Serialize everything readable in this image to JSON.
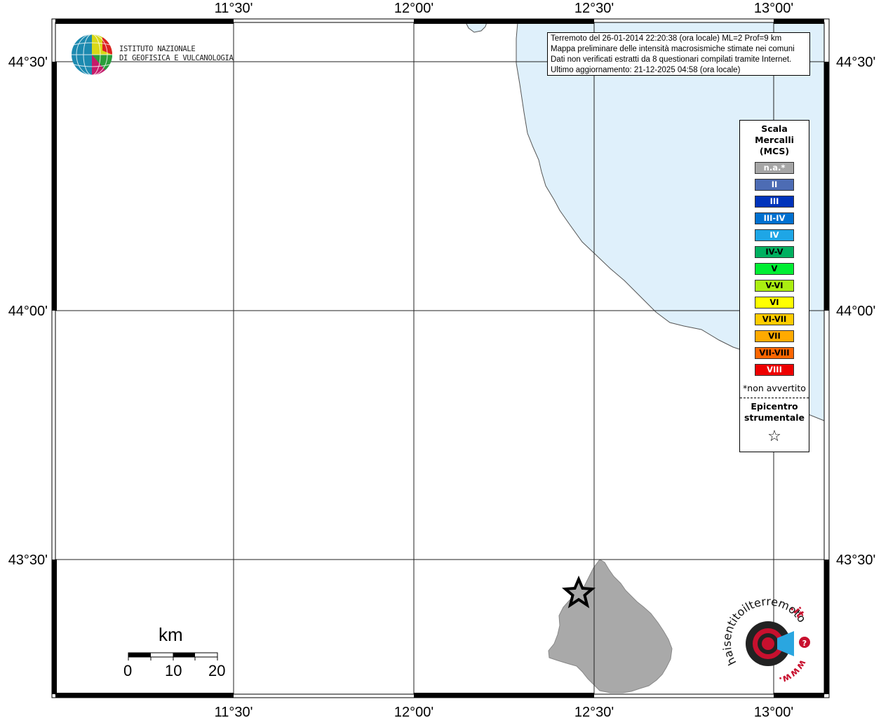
{
  "map": {
    "longitude_labels": [
      "11°30'",
      "12°00'",
      "12°30'",
      "13°00'"
    ],
    "latitude_labels": [
      "44°30'",
      "44°00'",
      "43°30'"
    ],
    "sea_color": "#dff0fb",
    "land_region_color": "#a9a9a9"
  },
  "logo": {
    "line1": "ISTITUTO NAZIONALE",
    "line2": "DI GEOFISICA E VULCANOLOGIA"
  },
  "info": {
    "line1": "Terremoto del 26-01-2014 22:20:38 (ora locale) ML=2 Prof=9 km",
    "line2": "Mappa preliminare delle intensità macrosismiche stimate nei comuni",
    "line3": "Dati non verificati estratti da 8 questionari compilati tramite Internet.",
    "line4": "Ultimo aggiornamento: 21-12-2025 04:58 (ora locale)"
  },
  "legend": {
    "title_line1": "Scala",
    "title_line2": "Mercalli",
    "title_line3": "(MCS)",
    "items": [
      {
        "label": "n.a.*",
        "color": "#a6a6a6",
        "text_color": "#ffffff"
      },
      {
        "label": "II",
        "color": "#4d6cb4",
        "text_color": "#ffffff"
      },
      {
        "label": "III",
        "color": "#0033bb",
        "text_color": "#ffffff"
      },
      {
        "label": "III-IV",
        "color": "#0070d0",
        "text_color": "#ffffff"
      },
      {
        "label": "IV",
        "color": "#1ea6e6",
        "text_color": "#ffffff"
      },
      {
        "label": "IV-V",
        "color": "#00b060",
        "text_color": "#000000"
      },
      {
        "label": "V",
        "color": "#00ee33",
        "text_color": "#000000"
      },
      {
        "label": "V-VI",
        "color": "#aaee11",
        "text_color": "#000000"
      },
      {
        "label": "VI",
        "color": "#ffff00",
        "text_color": "#000000"
      },
      {
        "label": "VI-VII",
        "color": "#ffcc00",
        "text_color": "#000000"
      },
      {
        "label": "VII",
        "color": "#ffaa00",
        "text_color": "#000000"
      },
      {
        "label": "VII-VIII",
        "color": "#ff6600",
        "text_color": "#000000"
      },
      {
        "label": "VIII",
        "color": "#ee0000",
        "text_color": "#ffffff"
      }
    ],
    "note": "*non avvertito",
    "epicenter_line1": "Epicentro",
    "epicenter_line2": "strumentale",
    "epicenter_symbol": "☆"
  },
  "scalebar": {
    "unit": "km",
    "labels": [
      "0",
      "10",
      "20"
    ]
  },
  "brand": {
    "text_main": "haisentitoilterremoto",
    "text_tld": ".it",
    "text_www": "www."
  }
}
